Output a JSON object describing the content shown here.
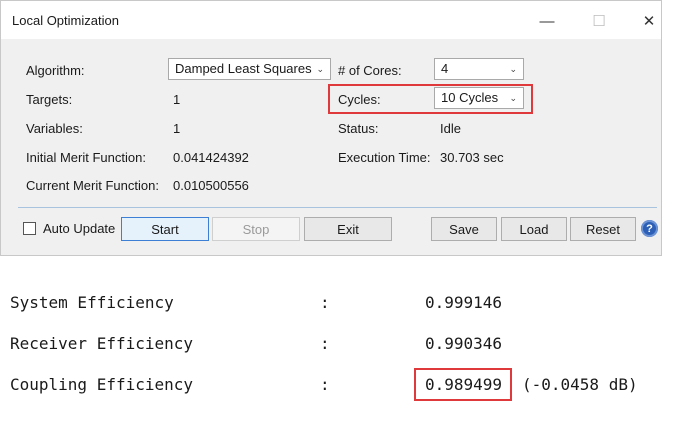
{
  "window": {
    "title": "Local Optimization",
    "minimize_glyph": "—",
    "maximize_glyph": "☐",
    "close_glyph": "✕"
  },
  "form": {
    "algorithm_label": "Algorithm:",
    "algorithm_value": "Damped Least Squares",
    "cores_label": "# of Cores:",
    "cores_value": "4",
    "targets_label": "Targets:",
    "targets_value": "1",
    "cycles_label": "Cycles:",
    "cycles_value": "10 Cycles",
    "variables_label": "Variables:",
    "variables_value": "1",
    "status_label": "Status:",
    "status_value": "Idle",
    "initial_merit_label": "Initial Merit Function:",
    "initial_merit_value": "0.041424392",
    "execution_time_label": "Execution Time:",
    "execution_time_value": "30.703 sec",
    "current_merit_label": "Current Merit Function:",
    "current_merit_value": "0.010500556"
  },
  "buttons": {
    "auto_update_label": "Auto Update",
    "auto_update_checked": false,
    "start": "Start",
    "stop": "Stop",
    "exit": "Exit",
    "save": "Save",
    "load": "Load",
    "reset": "Reset",
    "help_glyph": "?"
  },
  "results": [
    {
      "label": "System Efficiency",
      "sep": ":",
      "value": "0.999146",
      "extra": ""
    },
    {
      "label": "Receiver Efficiency",
      "sep": ":",
      "value": "0.990346",
      "extra": ""
    },
    {
      "label": "Coupling Efficiency",
      "sep": ":",
      "value": "0.989499",
      "extra": "(-0.0458 dB)"
    }
  ],
  "colors": {
    "highlight": "#e0393b",
    "accent": "#2c5fb5"
  },
  "icons": [
    "minimize-icon",
    "maximize-icon",
    "close-icon",
    "chevron-down-icon",
    "help-icon"
  ]
}
